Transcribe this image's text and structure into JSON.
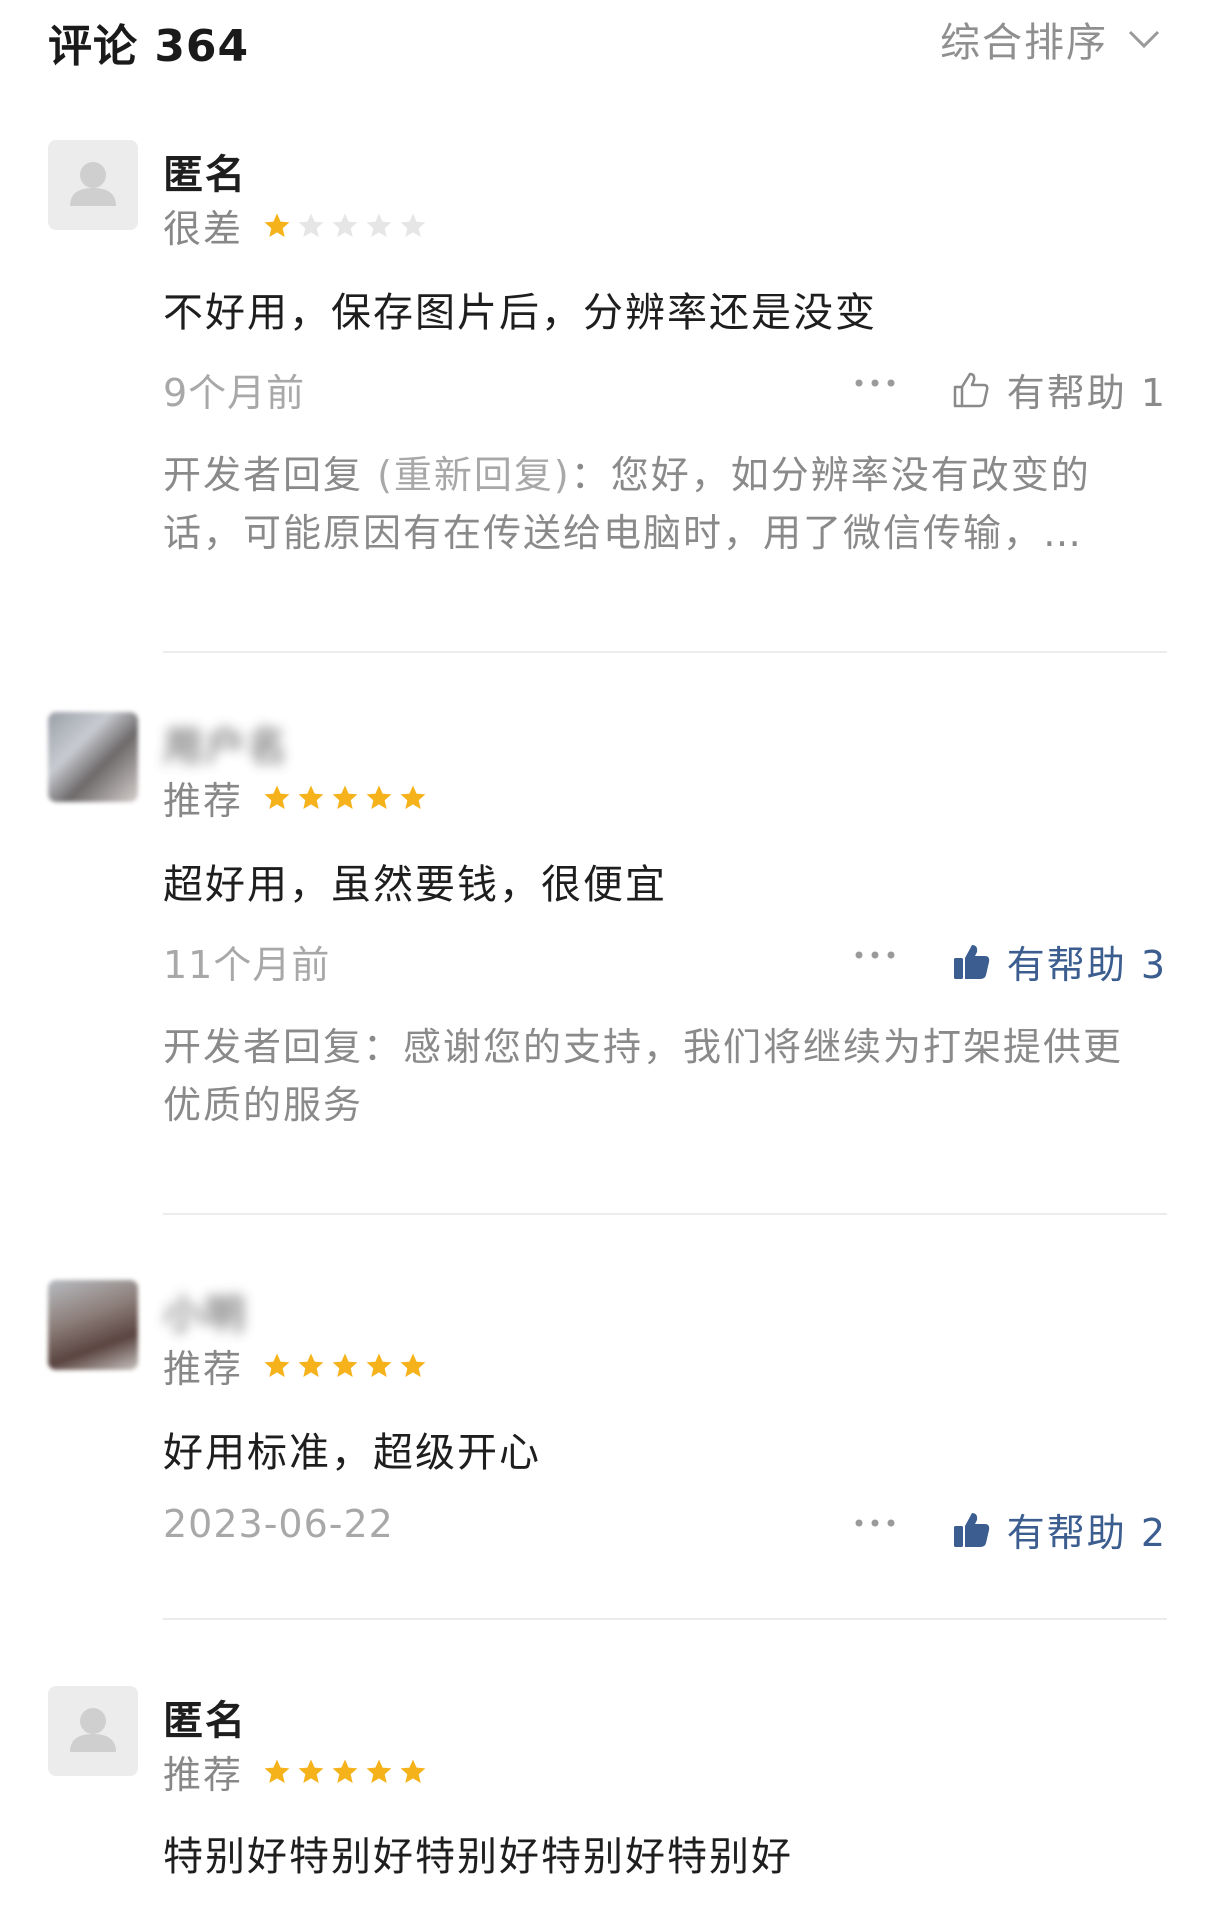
{
  "header": {
    "title": "评论 364",
    "sort_label": "综合排序"
  },
  "colors": {
    "star_filled": "#f5b21b",
    "star_empty": "#e6e6e6",
    "helpful_active": "#3c5d8f",
    "muted_text": "#8a8a8a"
  },
  "reviews": [
    {
      "username": "匿名",
      "rating_label": "很差",
      "stars": 1,
      "content": "不好用，保存图片后，分辨率还是没变",
      "time": "9个月前",
      "helpful": "有帮助 1",
      "helpful_active": false,
      "reply_prefix": "开发者回复 ",
      "reply_link": "(重新回复)",
      "reply_text": "：您好，如分辨率没有改变的话，可能原因有在传送给电脑时，用了微信传输，…"
    },
    {
      "username": "用户名",
      "rating_label": "推荐",
      "stars": 5,
      "content": "超好用，虽然要钱，很便宜",
      "time": "11个月前",
      "helpful": "有帮助 3",
      "helpful_active": true,
      "reply_prefix": "开发者回复",
      "reply_text": "：感谢您的支持，我们将继续为打架提供更优质的服务"
    },
    {
      "username": "小明",
      "rating_label": "推荐",
      "stars": 5,
      "content": "好用标准，超级开心",
      "time": "2023-06-22",
      "helpful": "有帮助 2",
      "helpful_active": true
    },
    {
      "username": "匿名",
      "rating_label": "推荐",
      "stars": 5,
      "content": "特别好特别好特别好特别好特别好"
    }
  ]
}
